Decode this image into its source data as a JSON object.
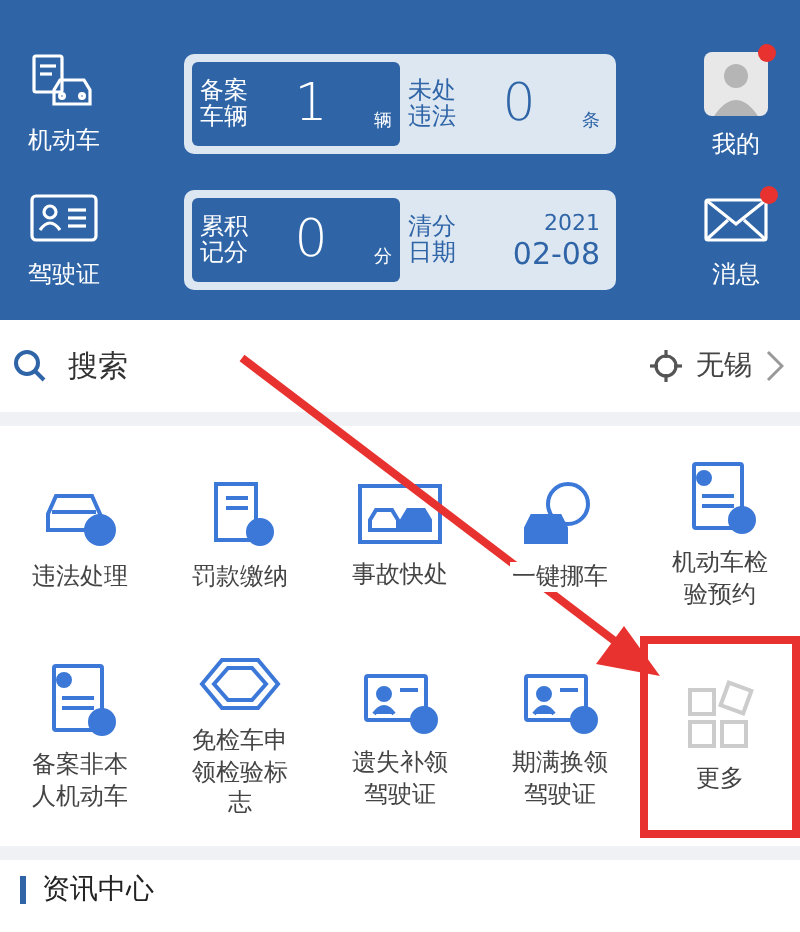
{
  "header": {
    "left_items": [
      {
        "label": "机动车",
        "kind": "car"
      },
      {
        "label": "驾驶证",
        "kind": "license"
      }
    ],
    "cards": [
      {
        "left": {
          "label": "备案车辆",
          "value": "1",
          "unit": "辆"
        },
        "right": {
          "kind": "count",
          "label": "未处违法",
          "value": "0",
          "unit": "条"
        }
      },
      {
        "left": {
          "label": "累积记分",
          "value": "0",
          "unit": "分"
        },
        "right": {
          "kind": "date",
          "label": "清分日期",
          "year": "2021",
          "date": "02-08"
        }
      }
    ],
    "right_items": [
      {
        "label": "我的",
        "kind": "avatar",
        "badge": true
      },
      {
        "label": "消息",
        "kind": "mail",
        "badge": true
      }
    ]
  },
  "search": {
    "placeholder": "搜索",
    "city": "无锡"
  },
  "services": [
    {
      "label": "违法处理",
      "kind": "car",
      "highlighted": false
    },
    {
      "label": "罚款缴纳",
      "kind": "scroll",
      "highlighted": false
    },
    {
      "label": "事故快处",
      "kind": "accident",
      "highlighted": false
    },
    {
      "label": "一键挪车",
      "kind": "move",
      "highlighted": false
    },
    {
      "label": "机动车检验预约",
      "kind": "doc",
      "highlighted": false
    },
    {
      "label": "备案非本人机动车",
      "kind": "doc",
      "highlighted": false
    },
    {
      "label": "免检车申领检验标志",
      "kind": "tag",
      "highlighted": false
    },
    {
      "label": "遗失补领驾驶证",
      "kind": "card",
      "highlighted": false
    },
    {
      "label": "期满换领驾驶证",
      "kind": "card",
      "highlighted": false
    },
    {
      "label": "更多",
      "kind": "more",
      "highlighted": true
    }
  ],
  "news": {
    "title": "资讯中心"
  }
}
